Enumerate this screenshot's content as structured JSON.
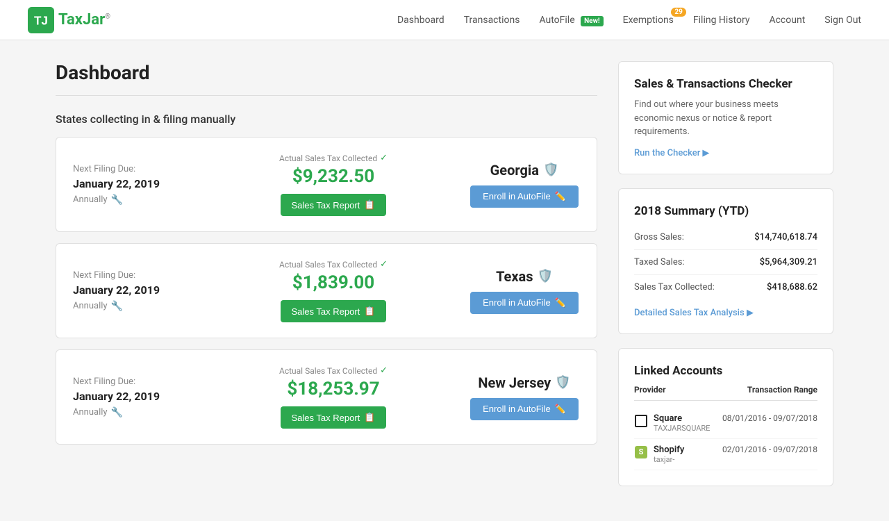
{
  "nav": {
    "logo_text": "TaxJar",
    "logo_reg": "®",
    "links": [
      {
        "id": "dashboard",
        "label": "Dashboard",
        "badge": null,
        "new_badge": null
      },
      {
        "id": "transactions",
        "label": "Transactions",
        "badge": null,
        "new_badge": null
      },
      {
        "id": "autofile",
        "label": "AutoFile",
        "badge": null,
        "new_badge": "New!"
      },
      {
        "id": "exemptions",
        "label": "Exemptions",
        "badge": "29",
        "new_badge": null
      },
      {
        "id": "filing-history",
        "label": "Filing History",
        "badge": null,
        "new_badge": null
      },
      {
        "id": "account",
        "label": "Account",
        "badge": null,
        "new_badge": null
      },
      {
        "id": "signout",
        "label": "Sign Out",
        "badge": null,
        "new_badge": null
      }
    ]
  },
  "page": {
    "title": "Dashboard",
    "section_heading": "States collecting in & filing manually"
  },
  "states": [
    {
      "id": "georgia",
      "next_filing_label": "Next Filing Due:",
      "next_filing_date": "January 22, 2019",
      "frequency": "Annually",
      "collected_label": "Actual Sales Tax Collected",
      "collected_amount": "$9,232.50",
      "report_btn": "Sales Tax Report",
      "state_name": "Georgia",
      "enroll_btn": "Enroll in AutoFile"
    },
    {
      "id": "texas",
      "next_filing_label": "Next Filing Due:",
      "next_filing_date": "January 22, 2019",
      "frequency": "Annually",
      "collected_label": "Actual Sales Tax Collected",
      "collected_amount": "$1,839.00",
      "report_btn": "Sales Tax Report",
      "state_name": "Texas",
      "enroll_btn": "Enroll in AutoFile"
    },
    {
      "id": "new-jersey",
      "next_filing_label": "Next Filing Due:",
      "next_filing_date": "January 22, 2019",
      "frequency": "Annually",
      "collected_label": "Actual Sales Tax Collected",
      "collected_amount": "$18,253.97",
      "report_btn": "Sales Tax Report",
      "state_name": "New Jersey",
      "enroll_btn": "Enroll in AutoFile"
    }
  ],
  "checker": {
    "title": "Sales & Transactions Checker",
    "description": "Find out where your business meets economic nexus or notice & report requirements.",
    "link": "Run the Checker"
  },
  "summary": {
    "title": "2018 Summary (YTD)",
    "rows": [
      {
        "label": "Gross Sales:",
        "value": "$14,740,618.74"
      },
      {
        "label": "Taxed Sales:",
        "value": "$5,964,309.21"
      },
      {
        "label": "Sales Tax Collected:",
        "value": "$418,688.62"
      }
    ],
    "analysis_link": "Detailed Sales Tax Analysis"
  },
  "linked_accounts": {
    "title": "Linked Accounts",
    "col_provider": "Provider",
    "col_range": "Transaction Range",
    "accounts": [
      {
        "id": "square",
        "icon_type": "square",
        "name": "Square",
        "sub": "TAXJARSQUARE",
        "range": "08/01/2016 - 09/07/2018"
      },
      {
        "id": "shopify",
        "icon_type": "shopify",
        "name": "Shopify",
        "sub": "taxjar-",
        "range": "02/01/2016 - 09/07/2018"
      }
    ]
  }
}
